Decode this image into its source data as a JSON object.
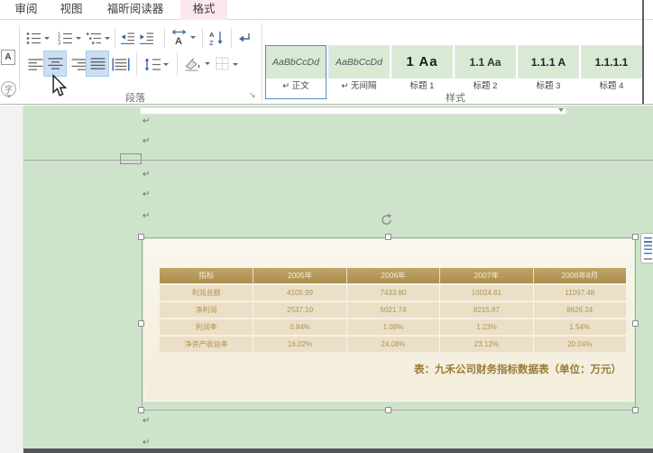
{
  "tab_bar": {
    "tabs": [
      {
        "label": "审阅",
        "active": false
      },
      {
        "label": "视图",
        "active": false
      },
      {
        "label": "福昕阅读器",
        "active": false
      },
      {
        "label": "格式",
        "active": true
      }
    ]
  },
  "ribbon": {
    "font_group": {
      "char_border_letter": "A",
      "enclose_char_letter": "字"
    },
    "paragraph_group": {
      "label": "段落",
      "row1_buttons": [
        "bullets",
        "numbering",
        "multilevel-list",
        "decrease-indent",
        "increase-indent",
        "asian-layout",
        "sort",
        "show-formatting-marks"
      ],
      "row2_buttons": [
        "align-left",
        "align-center",
        "align-right",
        "justify",
        "distribute-text",
        "line-spacing",
        "shading",
        "borders"
      ],
      "highlighted_buttons": [
        "align-center",
        "justify"
      ],
      "sort_a": "A",
      "sort_z": "Z",
      "asian_a": "A"
    },
    "styles_group": {
      "label": "样式",
      "items": [
        {
          "preview": "AaBbCcDd",
          "label": "↵ 正文",
          "selected": true
        },
        {
          "preview": "AaBbCcDd",
          "label": "↵ 无间隔",
          "selected": false
        },
        {
          "preview": "1 Aa",
          "label": "标题 1",
          "selected": false
        },
        {
          "preview": "1.1 Aa",
          "label": "标题 2",
          "selected": false
        },
        {
          "preview": "1.1.1 A",
          "label": "标题 3",
          "selected": false
        },
        {
          "preview": "1.1.1.1",
          "label": "标题 4",
          "selected": false
        }
      ]
    }
  },
  "document": {
    "pilcrow": "↵",
    "table": {
      "headers": [
        "指标",
        "2005年",
        "2006年",
        "2007年",
        "2008年8月"
      ],
      "rows": [
        {
          "label": "利润总额",
          "values": [
            "4105.99",
            "7433.80",
            "10024.61",
            "11097.48"
          ]
        },
        {
          "label": "净利润",
          "values": [
            "2537.10",
            "5021.74",
            "8215.87",
            "8626.24"
          ]
        },
        {
          "label": "利润率",
          "values": [
            "0.84%",
            "1.08%",
            "1.23%",
            "1.54%"
          ]
        },
        {
          "label": "净资产收益率",
          "values": [
            "16.02%",
            "24.08%",
            "23.12%",
            "20.04%"
          ]
        }
      ],
      "caption": "表：九禾公司财务指标数据表（单位：万元）"
    }
  },
  "colors": {
    "active_tab_bg": "#fbe7ec",
    "button_highlight": "#cbdff4",
    "page_green": "#cee4ca",
    "panel_cream": "#f6f1e2",
    "table_header_bg": "#b5985c",
    "table_row_bg": "#ebe0c7",
    "table_text": "#ad9257",
    "caption_text": "#9a7b35",
    "style_selected_border": "#4f90cf"
  }
}
